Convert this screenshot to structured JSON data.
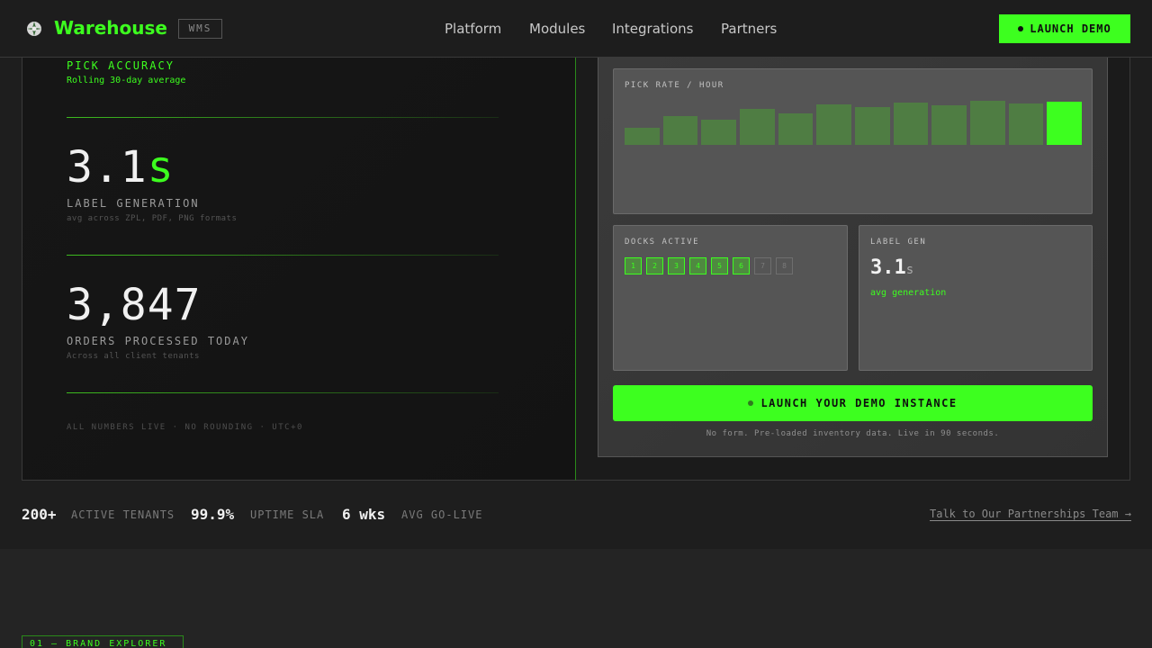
{
  "header": {
    "brand": "Warehouse",
    "brand_tag": "WMS",
    "nav": [
      "Platform",
      "Modules",
      "Integrations",
      "Partners"
    ],
    "launch_btn": "LAUNCH DEMO"
  },
  "left": {
    "accuracy_label": "PICK ACCURACY",
    "accuracy_sub": "Rolling 30-day average",
    "metrics": [
      {
        "value": "3.1",
        "unit": "s",
        "label": "LABEL GENERATION",
        "sub": "avg across ZPL, PDF, PNG formats"
      },
      {
        "value": "3,847",
        "unit": "",
        "label": "ORDERS PROCESSED TODAY",
        "sub": "Across all client tenants"
      }
    ],
    "footnote": "ALL NUMBERS LIVE · NO ROUNDING · UTC+0"
  },
  "dashboard": {
    "pick_rate_label": "PICK RATE / HOUR",
    "pick_rate_values": [
      0.38,
      0.64,
      0.55,
      0.79,
      0.7,
      0.89,
      0.83,
      0.94,
      0.87,
      0.98,
      0.91,
      0.96
    ],
    "docks_label": "DOCKS ACTIVE",
    "docks": [
      {
        "n": "1",
        "active": true
      },
      {
        "n": "2",
        "active": true
      },
      {
        "n": "3",
        "active": true
      },
      {
        "n": "4",
        "active": true
      },
      {
        "n": "5",
        "active": true
      },
      {
        "n": "6",
        "active": true
      },
      {
        "n": "7",
        "active": false
      },
      {
        "n": "8",
        "active": false
      }
    ],
    "label_gen_label": "LABEL GEN",
    "label_gen_value": "3.1",
    "label_gen_unit": "s",
    "label_gen_sub": "avg generation",
    "cta": "LAUNCH YOUR DEMO INSTANCE",
    "cta_note": "No form. Pre-loaded inventory data. Live in 90 seconds."
  },
  "stats": [
    {
      "num": "200+",
      "label": "ACTIVE TENANTS"
    },
    {
      "num": "99.9%",
      "label": "UPTIME SLA"
    },
    {
      "num": "6 wks",
      "label": "AVG GO-LIVE"
    }
  ],
  "partner_link": "Talk to Our Partnerships Team →",
  "section_tag": "01 — BRAND EXPLORER",
  "colors": {
    "accent": "#3dff1f",
    "bar": "#4f7d43"
  }
}
